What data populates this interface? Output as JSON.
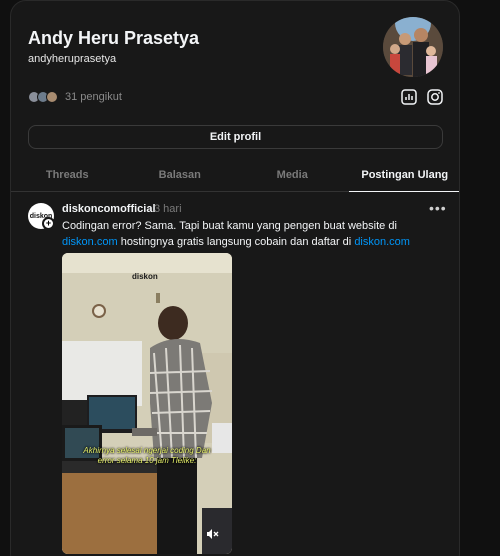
{
  "profile": {
    "name": "Andy Heru Prasetya",
    "handle": "andyheruprasetya",
    "followers_text": "31 pengikut",
    "edit_label": "Edit profil"
  },
  "tabs": [
    {
      "label": "Threads",
      "active": false
    },
    {
      "label": "Balasan",
      "active": false
    },
    {
      "label": "Media",
      "active": false
    },
    {
      "label": "Postingan Ulang",
      "active": true
    }
  ],
  "post": {
    "avatar_text": "diskon",
    "username": "diskoncomofficial",
    "time": "3 hari",
    "more_icon": "more-horizontal-icon",
    "text_part1": "Codingan error? Sama. Tapi buat kamu yang pengen buat website di ",
    "link1": "diskon.com",
    "text_part2": " hostingnya gratis langsung cobain dan daftar di ",
    "link2": "diskon.com",
    "media": {
      "logo_text": "diskon",
      "caption": "Akhirnya selesai ngerjai coding Dan error selama 10 jam Tlelike:"
    }
  },
  "colors": {
    "background": "#101010",
    "panel": "#181818",
    "link": "#0095f6",
    "caption": "#e8f26b"
  }
}
